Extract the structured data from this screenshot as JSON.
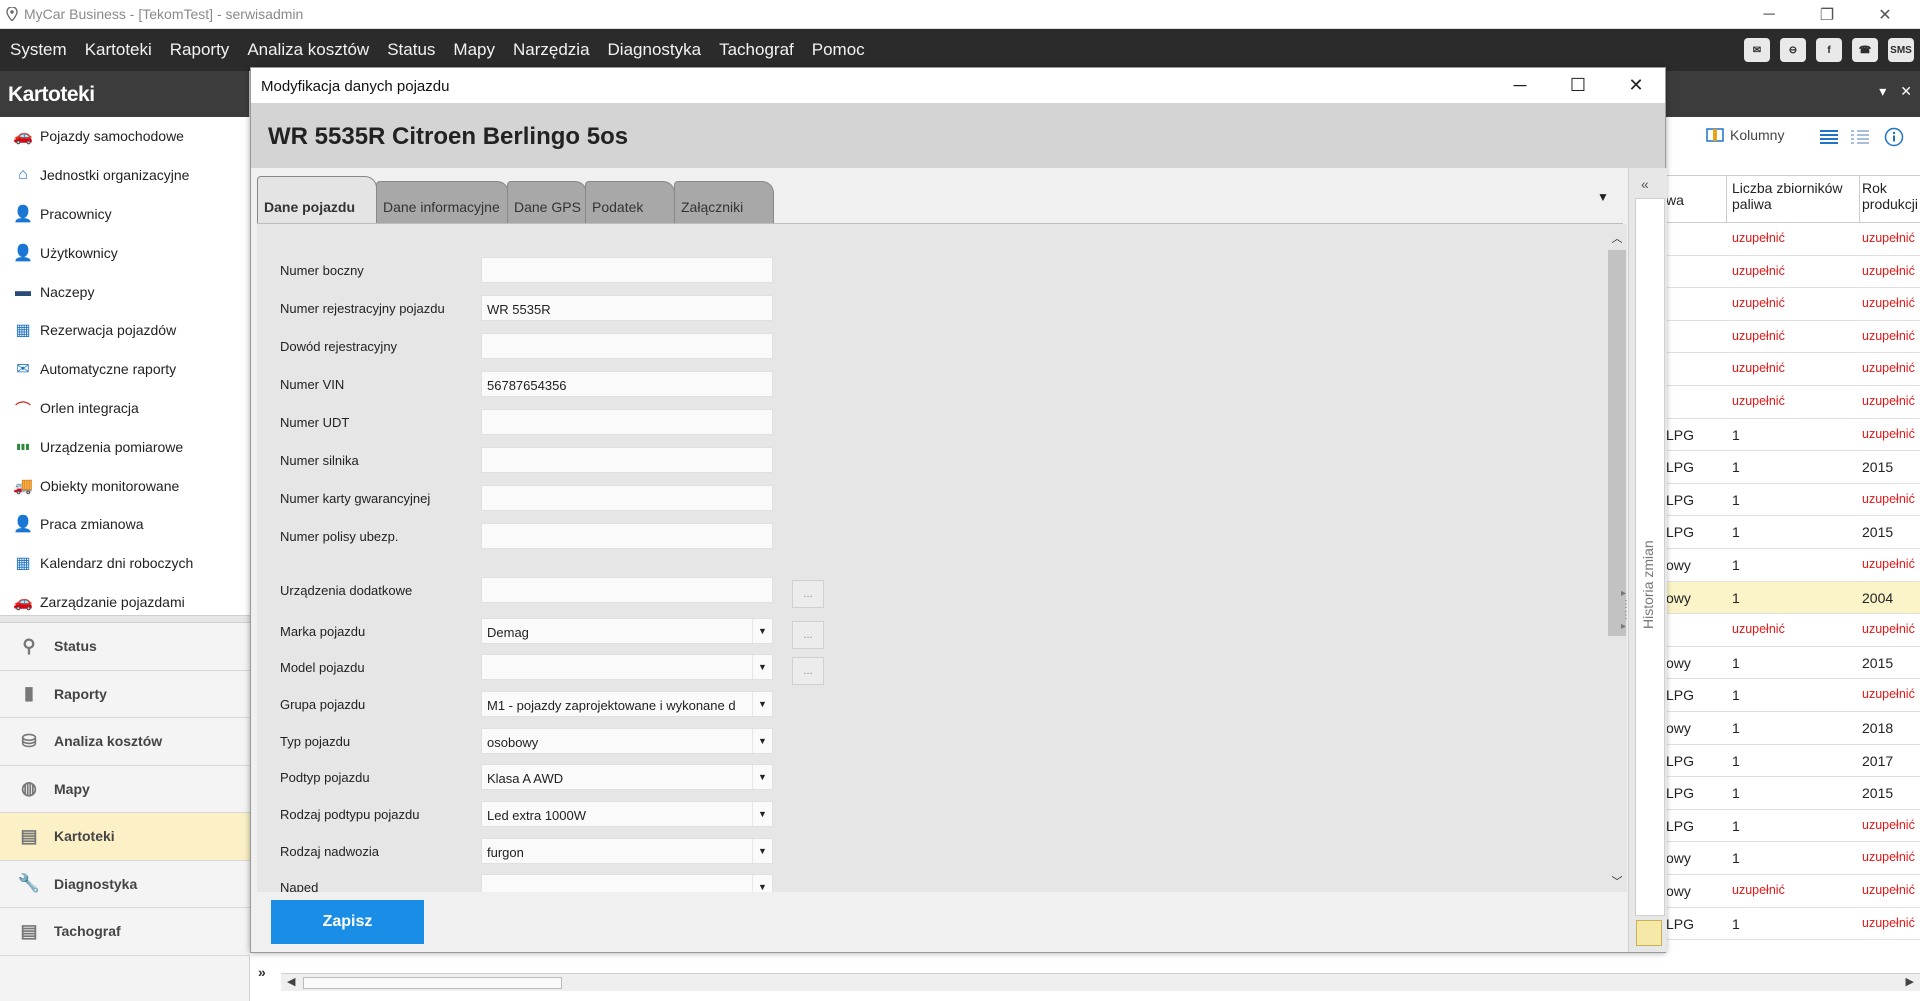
{
  "window": {
    "title": "MyCar Business - [TekomTest] -  serwisadmin",
    "controls": {
      "minimize": "─",
      "restore": "❐",
      "close": "✕"
    }
  },
  "menu": {
    "items": [
      "System",
      "Kartoteki",
      "Raporty",
      "Analiza kosztów",
      "Status",
      "Mapy",
      "Narzędzia",
      "Diagnostyka",
      "Tachograf",
      "Pomoc"
    ],
    "right_icons": [
      {
        "name": "mail-alert-icon",
        "glyph": "✉"
      },
      {
        "name": "minus-circle-icon",
        "glyph": "⊖"
      },
      {
        "name": "facebook-icon",
        "glyph": "f"
      },
      {
        "name": "phone-icon",
        "glyph": "☎"
      },
      {
        "name": "sms-icon",
        "glyph": "SMS"
      }
    ]
  },
  "left_panel": {
    "title": "Kartoteki",
    "nav": [
      {
        "label": "Pojazdy samochodowe",
        "icon": "car-icon",
        "glyph": "🚗",
        "color": "#e8a317"
      },
      {
        "label": "Jednostki organizacyjne",
        "icon": "home-icon",
        "glyph": "⌂",
        "color": "#1f73c9"
      },
      {
        "label": "Pracownicy",
        "icon": "person-icon",
        "glyph": "👤",
        "color": "#1f73c9"
      },
      {
        "label": "Użytkownicy",
        "icon": "user-check-icon",
        "glyph": "👤",
        "color": "#3a9a3a"
      },
      {
        "label": "Naczepy",
        "icon": "trailer-icon",
        "glyph": "▬",
        "color": "#2a4a7a"
      },
      {
        "label": "Rezerwacja pojazdów",
        "icon": "calendar-icon",
        "glyph": "▦",
        "color": "#1f73c9"
      },
      {
        "label": "Automatyczne raporty",
        "icon": "mail-clock-icon",
        "glyph": "✉",
        "color": "#1f73c9"
      },
      {
        "label": "Orlen integracja",
        "icon": "orlen-icon",
        "glyph": "⌒",
        "color": "#d01c1c"
      },
      {
        "label": "Urządzenia pomiarowe",
        "icon": "gauge-bars-icon",
        "glyph": "▮▮▮",
        "color": "#2a8a3a"
      },
      {
        "label": "Obiekty monitorowane",
        "icon": "truck-search-icon",
        "glyph": "🚚",
        "color": "#1f73c9"
      },
      {
        "label": "Praca zmianowa",
        "icon": "person-clock-icon",
        "glyph": "👤",
        "color": "#2a4a7a"
      },
      {
        "label": "Kalendarz dni roboczych",
        "icon": "calendar-days-icon",
        "glyph": "▦",
        "color": "#1f73c9"
      },
      {
        "label": "Zarządzanie pojazdami",
        "icon": "cars-icon",
        "glyph": "🚗",
        "color": "#1f73c9"
      }
    ],
    "sections": [
      {
        "label": "Status",
        "icon": "pin-icon",
        "glyph": "⚲",
        "active": false
      },
      {
        "label": "Raporty",
        "icon": "bar-chart-icon",
        "glyph": "▮",
        "active": false
      },
      {
        "label": "Analiza kosztów",
        "icon": "coins-icon",
        "glyph": "⛁",
        "active": false
      },
      {
        "label": "Mapy",
        "icon": "globe-icon",
        "glyph": "◍",
        "active": false
      },
      {
        "label": "Kartoteki",
        "icon": "folder-icon",
        "glyph": "▤",
        "active": true
      },
      {
        "label": "Diagnostyka",
        "icon": "wrench-icon",
        "glyph": "🔧",
        "active": false
      },
      {
        "label": "Tachograf",
        "icon": "tachograph-icon",
        "glyph": "▤",
        "active": false
      }
    ],
    "expand_glyph": "»"
  },
  "background_grid": {
    "toolbar": {
      "kolumny_label": "Kolumny"
    },
    "headers": {
      "col_partial": "wa",
      "col_tanks": "Liczba zbiorników paliwa",
      "col_year": "Rok produkcji"
    },
    "rows": [
      {
        "a": "",
        "b": "uzupełnić",
        "c": "uzupełnić",
        "hl": false
      },
      {
        "a": "",
        "b": "uzupełnić",
        "c": "uzupełnić",
        "hl": false
      },
      {
        "a": "",
        "b": "uzupełnić",
        "c": "uzupełnić",
        "hl": false
      },
      {
        "a": "",
        "b": "uzupełnić",
        "c": "uzupełnić",
        "hl": false
      },
      {
        "a": "",
        "b": "uzupełnić",
        "c": "uzupełnić",
        "hl": false
      },
      {
        "a": "",
        "b": "uzupełnić",
        "c": "uzupełnić",
        "hl": false
      },
      {
        "a": "LPG",
        "b": "1",
        "c": "uzupełnić",
        "hl": false
      },
      {
        "a": "LPG",
        "b": "1",
        "c": "2015",
        "hl": false
      },
      {
        "a": "LPG",
        "b": "1",
        "c": "uzupełnić",
        "hl": false
      },
      {
        "a": "LPG",
        "b": "1",
        "c": "2015",
        "hl": false
      },
      {
        "a": "owy",
        "b": "1",
        "c": "uzupełnić",
        "hl": false
      },
      {
        "a": "owy",
        "b": "1",
        "c": "2004",
        "hl": true
      },
      {
        "a": "",
        "b": "uzupełnić",
        "c": "uzupełnić",
        "hl": false
      },
      {
        "a": "owy",
        "b": "1",
        "c": "2015",
        "hl": false
      },
      {
        "a": "LPG",
        "b": "1",
        "c": "uzupełnić",
        "hl": false
      },
      {
        "a": "owy",
        "b": "1",
        "c": "2018",
        "hl": false
      },
      {
        "a": "LPG",
        "b": "1",
        "c": "2017",
        "hl": false
      },
      {
        "a": "LPG",
        "b": "1",
        "c": "2015",
        "hl": false
      },
      {
        "a": "LPG",
        "b": "1",
        "c": "uzupełnić",
        "hl": false
      },
      {
        "a": "owy",
        "b": "1",
        "c": "uzupełnić",
        "hl": false
      },
      {
        "a": "owy",
        "b": "uzupełnić",
        "c": "uzupełnić",
        "hl": false
      },
      {
        "a": "LPG",
        "b": "1",
        "c": "uzupełnić",
        "hl": false
      }
    ]
  },
  "dialog": {
    "title": "Modyfikacja danych pojazdu",
    "vehicle_title": "WR 5535R Citroen Berlingo 5os",
    "tabs": [
      "Dane pojazdu",
      "Dane informacyjne",
      "Dane GPS",
      "Podatek",
      "Załączniki"
    ],
    "active_tab": 0,
    "fields": [
      {
        "label": "Numer boczny",
        "value": "",
        "kind": "text"
      },
      {
        "label": "Numer rejestracyjny pojazdu",
        "value": "WR 5535R",
        "kind": "text"
      },
      {
        "label": "Dowód rejestracyjny",
        "value": "",
        "kind": "text"
      },
      {
        "label": "Numer VIN",
        "value": "56787654356",
        "kind": "text"
      },
      {
        "label": "Numer UDT",
        "value": "",
        "kind": "text"
      },
      {
        "label": "Numer silnika",
        "value": "",
        "kind": "text"
      },
      {
        "label": "Numer karty gwarancyjnej",
        "value": "",
        "kind": "text"
      },
      {
        "label": "Numer polisy ubezp.",
        "value": "",
        "kind": "text"
      },
      {
        "label": "Urządzenia dodatkowe",
        "value": "",
        "kind": "text-dots"
      },
      {
        "label": "Marka pojazdu",
        "value": "Demag",
        "kind": "select-dots"
      },
      {
        "label": "Model pojazdu",
        "value": "",
        "kind": "select-dots"
      },
      {
        "label": "Grupa pojazdu",
        "value": "M1 - pojazdy zaprojektowane i wykonane d",
        "kind": "select"
      },
      {
        "label": "Typ pojazdu",
        "value": "osobowy",
        "kind": "select"
      },
      {
        "label": "Podtyp pojazdu",
        "value": "Klasa A AWD",
        "kind": "select"
      },
      {
        "label": "Rodzaj podtypu pojazdu",
        "value": "Led extra 1000W",
        "kind": "select"
      },
      {
        "label": "Rodzaj nadwozia",
        "value": "furgon",
        "kind": "select"
      },
      {
        "label": "Napęd",
        "value": "",
        "kind": "select"
      }
    ],
    "dots_label": "...",
    "save_label": "Zapisz",
    "history_label": "Historia zmian"
  },
  "colors": {
    "accent": "#1a8ee6",
    "required": "#e01818",
    "active_section": "#fbf0c6"
  }
}
